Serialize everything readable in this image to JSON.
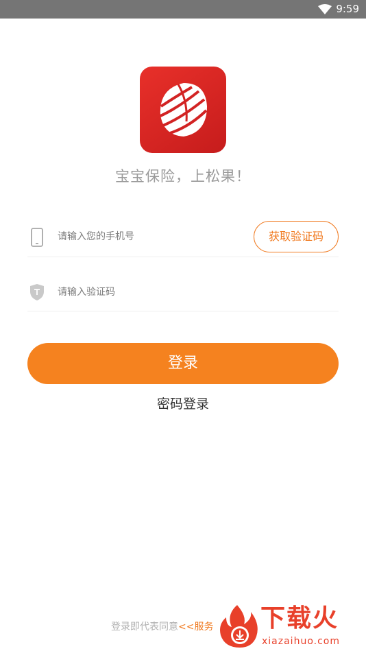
{
  "status_bar": {
    "time": "9:59",
    "icons": [
      "wifi-icon"
    ]
  },
  "app": {
    "logo_icon": "pinecone-logo-icon",
    "slogan": "宝宝保险，上松果！"
  },
  "form": {
    "phone_placeholder": "请输入您的手机号",
    "phone_icon": "phone-icon",
    "get_code_label": "获取验证码",
    "code_placeholder": "请输入验证码",
    "code_icon": "shield-icon"
  },
  "actions": {
    "login_label": "登录",
    "password_login_label": "密码登录"
  },
  "footer": {
    "agreement_prefix": "登录即代表同意",
    "agreement_link": "<<服务"
  },
  "watermark": {
    "title": "下载火",
    "url": "xiazaihuo.com"
  },
  "colors": {
    "accent": "#f5821f",
    "logo_red": "#d92323",
    "status_bar": "#757575",
    "hint_text": "#9a9a9a"
  }
}
